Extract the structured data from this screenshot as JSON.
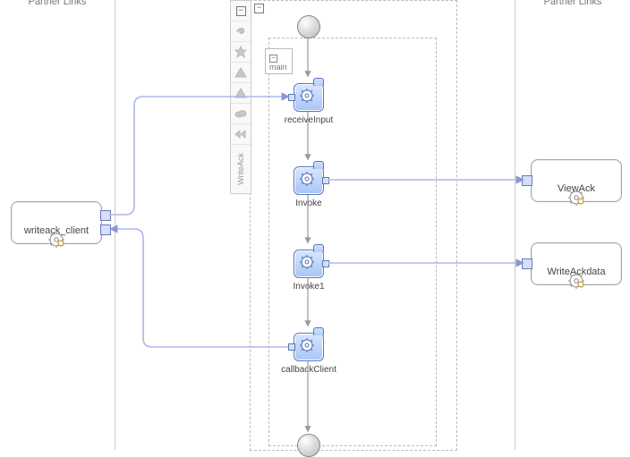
{
  "leftPanel": {
    "title": "Partner Links"
  },
  "rightPanel": {
    "title": "Partner Links"
  },
  "partnerLinks": {
    "left": [
      {
        "name": "writeack_client"
      }
    ],
    "right": [
      {
        "name": "ViewAck"
      },
      {
        "name": "WriteAckdata"
      }
    ]
  },
  "scope": {
    "name": "main"
  },
  "activities": {
    "receiveInput": {
      "label": "receiveInput"
    },
    "invoke": {
      "label": "Invoke"
    },
    "invoke1": {
      "label": "Invoke1"
    },
    "callbackClient": {
      "label": "callbackClient"
    }
  },
  "toolbar": {
    "label": "WriteAck"
  }
}
